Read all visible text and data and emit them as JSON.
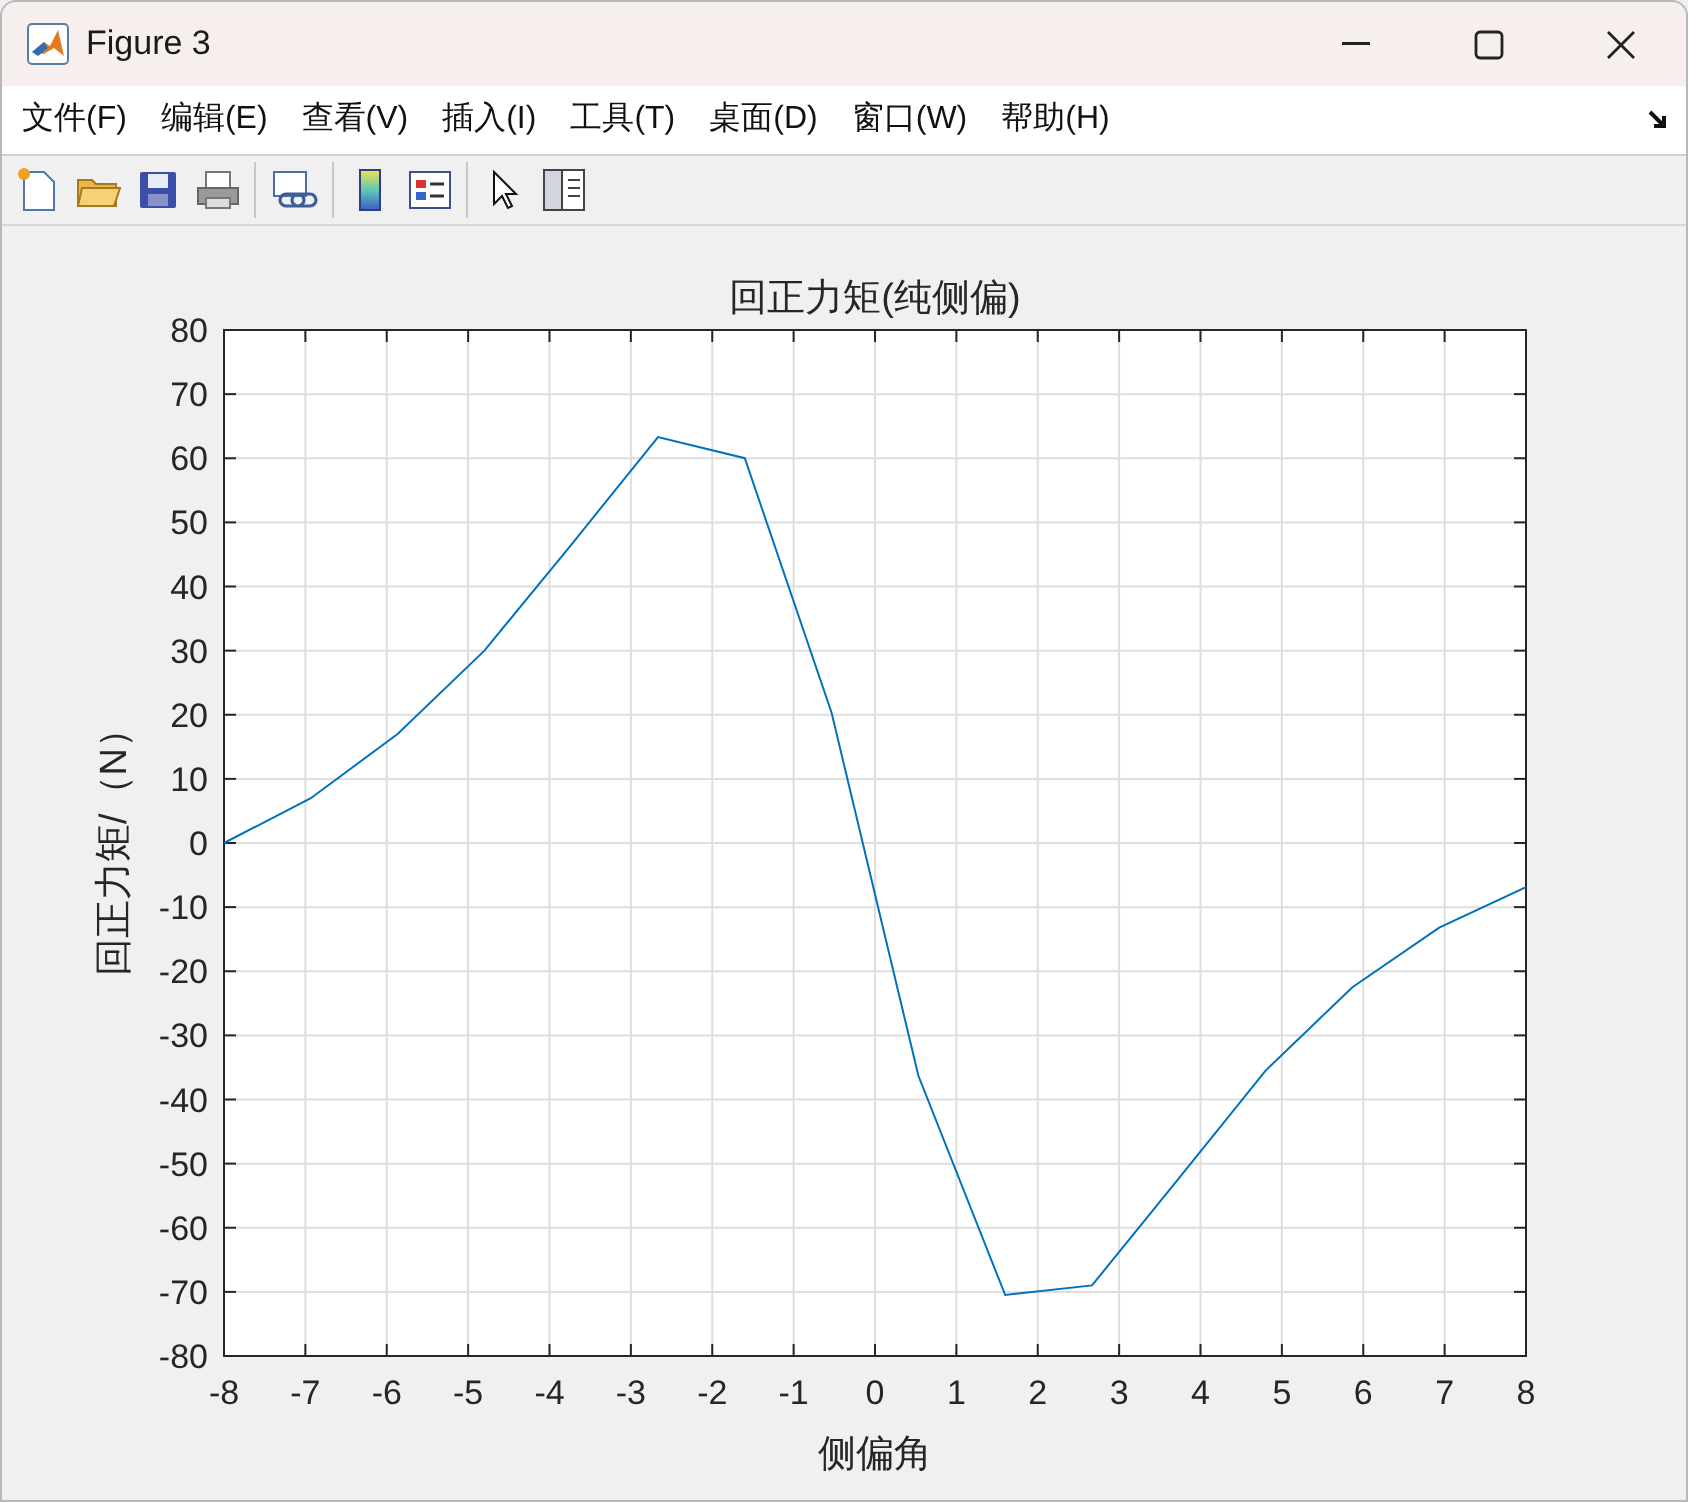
{
  "window": {
    "title": "Figure 3"
  },
  "menu": [
    "文件(F)",
    "编辑(E)",
    "查看(V)",
    "插入(I)",
    "工具(T)",
    "桌面(D)",
    "窗口(W)",
    "帮助(H)"
  ],
  "chart_data": {
    "type": "line",
    "title": "回正力矩(纯侧偏)",
    "xlabel": "侧偏角",
    "ylabel": "回正力矩/（N）",
    "xlim": [
      -8,
      8
    ],
    "ylim": [
      -80,
      80
    ],
    "xticks": [
      -8,
      -7,
      -6,
      -5,
      -4,
      -3,
      -2,
      -1,
      0,
      1,
      2,
      3,
      4,
      5,
      6,
      7,
      8
    ],
    "yticks": [
      -80,
      -70,
      -60,
      -50,
      -40,
      -30,
      -20,
      -10,
      0,
      10,
      20,
      30,
      40,
      50,
      60,
      70,
      80
    ],
    "x": [
      -8,
      -6.933,
      -5.867,
      -4.8,
      -3.733,
      -2.667,
      -1.6,
      -0.533,
      0.533,
      1.6,
      2.667,
      3.733,
      4.8,
      5.867,
      6.933,
      8
    ],
    "grid": true,
    "series": [
      {
        "color": "#0072bd",
        "values": [
          0,
          7,
          17,
          30,
          46.5,
          63.3,
          60,
          20.3,
          -36.3,
          -70.5,
          -69,
          -52.3,
          -35.5,
          -22.5,
          -13.2,
          -6.9
        ]
      }
    ]
  }
}
